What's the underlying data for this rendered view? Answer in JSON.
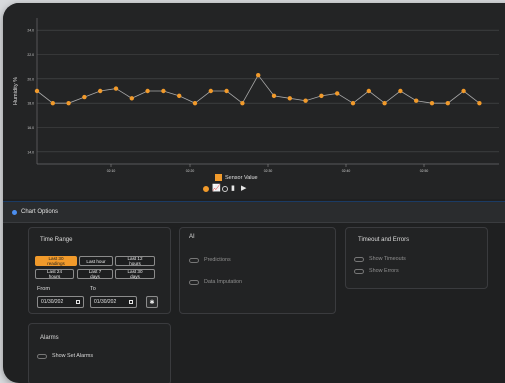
{
  "colors": {
    "accent": "#f19a2b",
    "background": "#1f2021",
    "grid": "#4a4b4d",
    "link": "#2f64b9"
  },
  "chart_data": {
    "type": "line",
    "ylabel": "Humidity %",
    "y_ticks": [
      "24.0",
      "22.0",
      "20.0",
      "18.0",
      "16.0",
      "14.0"
    ],
    "ylim": [
      13,
      25
    ],
    "x_ticks": [
      "02:10",
      "02:20",
      "02:30",
      "02:40",
      "02:50",
      "03:00"
    ],
    "series": [
      {
        "name": "Sensor Value",
        "values": [
          19.0,
          18.0,
          18.0,
          18.5,
          19.0,
          19.2,
          18.4,
          19.0,
          19.0,
          18.6,
          18.0,
          19.0,
          19.0,
          18.0,
          20.3,
          18.6,
          18.4,
          18.2,
          18.6,
          18.8,
          18.0,
          19.0,
          18.0,
          19.0,
          18.2,
          18.0,
          18.0,
          19.0,
          18.0
        ]
      }
    ],
    "legend": "bottom-center",
    "grid": true
  },
  "view_toggle": {
    "line_icon": "line-chart-icon",
    "bar_icon": "bar-chart-icon",
    "extra_icon": "export-icon"
  },
  "options": {
    "label": "Chart Options"
  },
  "time_range": {
    "title": "Time Range",
    "buttons": [
      "Last 30 readings",
      "Last hour",
      "Last 12 hours",
      "Last 24 hours",
      "Last 7 days",
      "Last 30 days"
    ],
    "active_index": 0,
    "from_label": "From",
    "to_label": "To",
    "from_value": "01/30/202",
    "to_value": "01/30/202",
    "apply_icon": "apply-icon"
  },
  "alarms": {
    "title": "Alarms",
    "toggle_label": "Show Set Alarms"
  },
  "ai": {
    "title": "AI",
    "predictions_label": "Predictions",
    "link_text": "",
    "imputation_label": "Data Imputation"
  },
  "timeouts": {
    "title": "Timeout and Errors",
    "timeouts_label": "Show Timeouts",
    "errors_label": "Show Errors"
  }
}
